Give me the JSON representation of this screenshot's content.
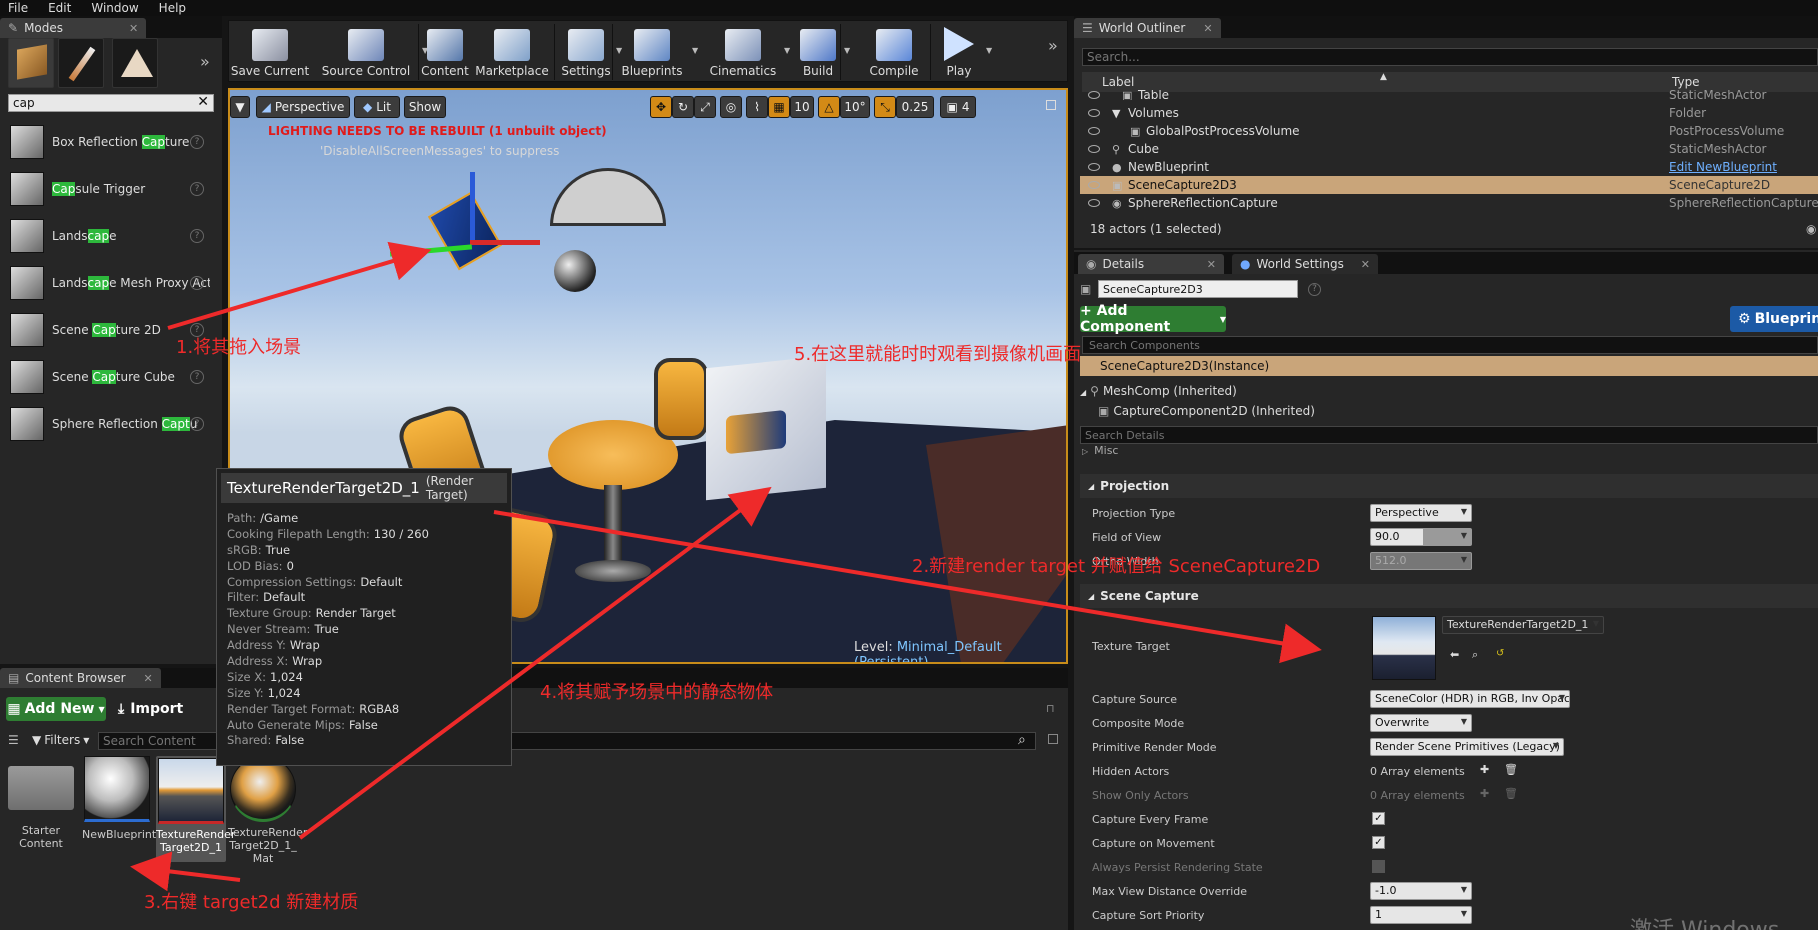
{
  "menu": [
    "File",
    "Edit",
    "Window",
    "Help"
  ],
  "modes": {
    "tab": "Modes",
    "search_value": "cap",
    "items": [
      {
        "pre": "Box Reflection ",
        "hl": "Cap",
        "post": "ture"
      },
      {
        "pre": "",
        "hl": "Cap",
        "post": "sule Trigger"
      },
      {
        "pre": "Lands",
        "hl": "cap",
        "post": "e"
      },
      {
        "pre": "Lands",
        "hl": "cap",
        "post": "e Mesh Proxy Act"
      },
      {
        "pre": "Scene ",
        "hl": "Cap",
        "post": "ture 2D"
      },
      {
        "pre": "Scene ",
        "hl": "Cap",
        "post": "ture Cube"
      },
      {
        "pre": "Sphere Reflection ",
        "hl": "Capt",
        "post": "u"
      }
    ]
  },
  "toolbar": [
    "Save Current",
    "Source Control",
    "Content",
    "Marketplace",
    "Settings",
    "Blueprints",
    "Cinematics",
    "Build",
    "Compile",
    "Play"
  ],
  "viewport": {
    "perspective": "Perspective",
    "lit": "Lit",
    "show": "Show",
    "grid": "10",
    "angle": "10°",
    "scale": "0.25",
    "cam": "4",
    "warning": "LIGHTING NEEDS TO BE REBUILT (1 unbuilt object)",
    "suppress": "'DisableAllScreenMessages' to suppress",
    "level_label": "Level:",
    "level_value": "Minimal_Default (Persistent)"
  },
  "content_browser": {
    "tab": "Content Browser",
    "add_new": "Add New",
    "import": "Import",
    "filters": "Filters",
    "search_placeholder": "Search Content",
    "assets": [
      "Starter Content",
      "NewBlueprint",
      "TextureRender Target2D_1",
      "TextureRender Target2D_1_ Mat"
    ]
  },
  "tooltip": {
    "title": "TextureRenderTarget2D_1",
    "kind": "(Render Target)",
    "rows": [
      {
        "k": "Path:",
        "v": "/Game"
      },
      {
        "k": "Cooking Filepath Length:",
        "v": "130 / 260"
      },
      {
        "k": "sRGB:",
        "v": "True"
      },
      {
        "k": "LOD Bias:",
        "v": "0"
      },
      {
        "k": "Compression Settings:",
        "v": "Default"
      },
      {
        "k": "Filter:",
        "v": "Default"
      },
      {
        "k": "Texture Group:",
        "v": "Render Target"
      },
      {
        "k": "Never Stream:",
        "v": "True"
      },
      {
        "k": "Address Y:",
        "v": "Wrap"
      },
      {
        "k": "Address X:",
        "v": "Wrap"
      },
      {
        "k": "Size X:",
        "v": "1,024"
      },
      {
        "k": "Size Y:",
        "v": "1,024"
      },
      {
        "k": "Render Target Format:",
        "v": "RGBA8"
      },
      {
        "k": "Auto Generate Mips:",
        "v": "False"
      },
      {
        "k": "Shared:",
        "v": "False"
      }
    ]
  },
  "outliner": {
    "tab": "World Outliner",
    "search_placeholder": "Search...",
    "col_label": "Label",
    "col_type": "Type",
    "rows": [
      {
        "label": "Table",
        "type": "StaticMeshActor"
      },
      {
        "label": "Volumes",
        "type": "Folder"
      },
      {
        "label": "GlobalPostProcessVolume",
        "type": "PostProcessVolume"
      },
      {
        "label": "Cube",
        "type": "StaticMeshActor"
      },
      {
        "label": "NewBlueprint",
        "type": "Edit NewBlueprint"
      },
      {
        "label": "SceneCapture2D3",
        "type": "SceneCapture2D"
      },
      {
        "label": "SphereReflectionCapture",
        "type": "SphereReflectionCapture"
      }
    ],
    "count": "18 actors (1 selected)"
  },
  "details": {
    "tab": "Details",
    "tab2": "World Settings",
    "name_value": "SceneCapture2D3",
    "add_component": "+ Add Component",
    "blueprint": "Blueprin",
    "search_components": "Search Components",
    "instance": "SceneCapture2D3(Instance)",
    "meshcomp": "MeshComp (Inherited)",
    "capturecomp": "CaptureComponent2D (Inherited)",
    "search_details": "Search Details",
    "misc": "Misc",
    "proj_section": "Projection",
    "projection_type": {
      "label": "Projection Type",
      "value": "Perspective"
    },
    "fov": {
      "label": "Field of View",
      "value": "90.0"
    },
    "ortho": {
      "label": "Ortho Width",
      "value": "512.0"
    },
    "capture_section": "Scene Capture",
    "texture_target": {
      "label": "Texture Target",
      "value": "TextureRenderTarget2D_1"
    },
    "capture_source": {
      "label": "Capture Source",
      "value": "SceneColor (HDR) in RGB, Inv Opacity in A"
    },
    "composite_mode": {
      "label": "Composite Mode",
      "value": "Overwrite"
    },
    "prim_render": {
      "label": "Primitive Render Mode",
      "value": "Render Scene Primitives (Legacy)"
    },
    "hidden_actors": {
      "label": "Hidden Actors",
      "value": "0 Array elements"
    },
    "show_only": {
      "label": "Show Only Actors",
      "value": "0 Array elements"
    },
    "every_frame": {
      "label": "Capture Every Frame"
    },
    "on_movement": {
      "label": "Capture on Movement"
    },
    "persist": {
      "label": "Always Persist Rendering State"
    },
    "max_view": {
      "label": "Max View Distance Override",
      "value": "-1.0"
    },
    "sort_priority": {
      "label": "Capture Sort Priority",
      "value": "1"
    }
  },
  "annotations": {
    "a1": "1.将其拖入场景",
    "a2": "2.新建render target 并赋值给 SceneCapture2D",
    "a3": "3.右键 target2d 新建材质",
    "a4": "4.将其赋予场景中的静态物体",
    "a5": "5.在这里就能时时观看到摄像机画面"
  },
  "watermark": "激活 Windows",
  "colors": {
    "accent": "#c88c1a",
    "selected_row": "#c9a57a",
    "annotation": "#ee2a2a",
    "add_button": "#2e7d32",
    "blueprint_button": "#1c5aa6"
  }
}
